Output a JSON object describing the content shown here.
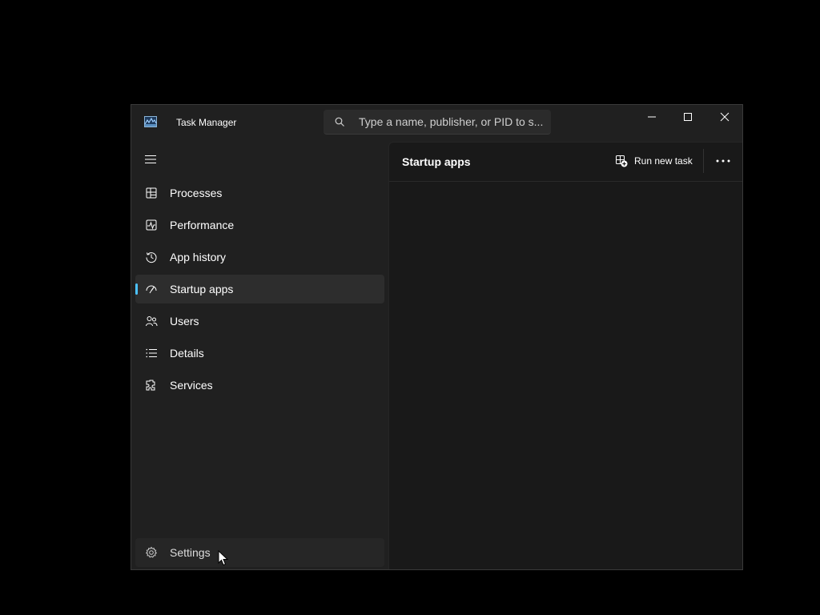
{
  "window": {
    "title": "Task Manager",
    "app_icon": "task-manager-icon",
    "controls": [
      "minimize-icon",
      "maximize-icon",
      "close-icon"
    ]
  },
  "search": {
    "placeholder": "Type a name, publisher, or PID to s..."
  },
  "sidebar": {
    "menu_icon": "hamburger-icon",
    "items": [
      {
        "label": "Processes",
        "icon": "processes-icon"
      },
      {
        "label": "Performance",
        "icon": "performance-icon"
      },
      {
        "label": "App history",
        "icon": "history-icon"
      },
      {
        "label": "Startup apps",
        "icon": "startup-icon",
        "active": true
      },
      {
        "label": "Users",
        "icon": "users-icon"
      },
      {
        "label": "Details",
        "icon": "details-icon"
      },
      {
        "label": "Services",
        "icon": "services-icon"
      }
    ],
    "settings": {
      "label": "Settings",
      "icon": "gear-icon"
    }
  },
  "content": {
    "title": "Startup apps",
    "run_new_task_label": "Run new task",
    "more_icon": "more-options-icon"
  },
  "colors": {
    "accent": "#4cc2ff",
    "window_bg": "#202020",
    "content_bg": "#191919",
    "active_item_bg": "#2d2d2d"
  }
}
